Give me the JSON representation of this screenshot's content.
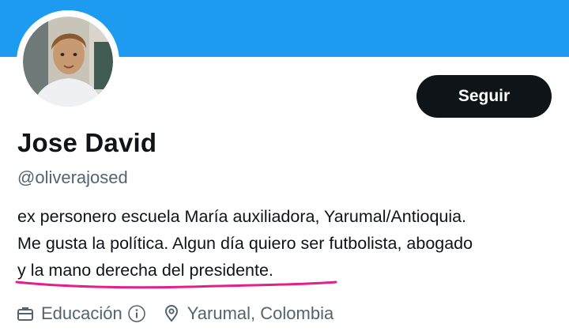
{
  "colors": {
    "banner": "#1d9bf0",
    "text_primary": "#0f1419",
    "text_secondary": "#536471",
    "button_bg": "#0f1419",
    "button_text": "#ffffff",
    "underline_mark": "#e0218a"
  },
  "profile": {
    "display_name": "Jose David",
    "handle": "@oliverajosed",
    "follow_label": "Seguir",
    "bio_lines": [
      "ex personero escuela María auxiliadora, Yarumal/Antioquia.",
      "Me gusta la política. Algun día quiero ser futbolista, abogado",
      "y la mano derecha del presidente."
    ],
    "category": "Educación",
    "location": "Yarumal, Colombia"
  },
  "icons": {
    "category": "briefcase-icon",
    "category_info": "info-icon",
    "location": "location-pin-icon"
  }
}
